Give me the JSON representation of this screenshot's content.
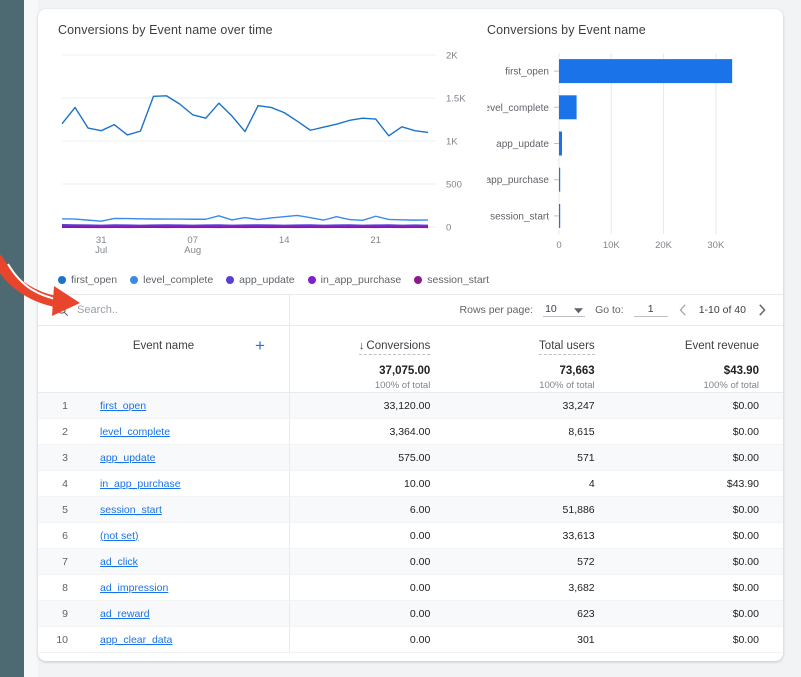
{
  "theme": {
    "accent": "#1a73e8",
    "rail": "#4d6a72",
    "bar_fill": "#1a73e8",
    "annotation": "#e8452c",
    "text_primary": "#202124",
    "text_secondary": "#5f6368"
  },
  "search": {
    "placeholder": "Search..",
    "value": "",
    "icon": "search-icon"
  },
  "pager": {
    "rows_per_page_label": "Rows per page:",
    "rows_per_page_value": "10",
    "goto_label": "Go to:",
    "goto_value": "1",
    "range": "1-10 of 40",
    "prev_icon": "chevron-left-icon",
    "next_icon": "chevron-right-icon",
    "dropdown_icon": "caret-down-icon"
  },
  "table": {
    "dimension_header": "Event name",
    "add_dimension_icon": "plus-icon",
    "metrics": [
      {
        "header": "Conversions",
        "total": "37,075.00",
        "subtotal": "100% of total",
        "sorted": true,
        "sort_icon": "arrow-down-icon",
        "dotted": true
      },
      {
        "header": "Total users",
        "total": "73,663",
        "subtotal": "100% of total",
        "sorted": false,
        "dotted": true
      },
      {
        "header": "Event revenue",
        "total": "$43.90",
        "subtotal": "100% of total",
        "sorted": false,
        "dotted": false
      }
    ],
    "rows": [
      {
        "index": "1",
        "name": "first_open",
        "conversions": "33,120.00",
        "total_users": "33,247",
        "event_revenue": "$0.00"
      },
      {
        "index": "2",
        "name": "level_complete",
        "conversions": "3,364.00",
        "total_users": "8,615",
        "event_revenue": "$0.00"
      },
      {
        "index": "3",
        "name": "app_update",
        "conversions": "575.00",
        "total_users": "571",
        "event_revenue": "$0.00"
      },
      {
        "index": "4",
        "name": "in_app_purchase",
        "conversions": "10.00",
        "total_users": "4",
        "event_revenue": "$43.90"
      },
      {
        "index": "5",
        "name": "session_start",
        "conversions": "6.00",
        "total_users": "51,886",
        "event_revenue": "$0.00"
      },
      {
        "index": "6",
        "name": "(not set)",
        "conversions": "0.00",
        "total_users": "33,613",
        "event_revenue": "$0.00"
      },
      {
        "index": "7",
        "name": "ad_click",
        "conversions": "0.00",
        "total_users": "572",
        "event_revenue": "$0.00"
      },
      {
        "index": "8",
        "name": "ad_impression",
        "conversions": "0.00",
        "total_users": "3,682",
        "event_revenue": "$0.00"
      },
      {
        "index": "9",
        "name": "ad_reward",
        "conversions": "0.00",
        "total_users": "623",
        "event_revenue": "$0.00"
      },
      {
        "index": "10",
        "name": "app_clear_data",
        "conversions": "0.00",
        "total_users": "301",
        "event_revenue": "$0.00"
      }
    ]
  },
  "chart_data": [
    {
      "type": "line",
      "title": "Conversions by Event name over time",
      "xlabel": "",
      "ylabel": "",
      "ylim": [
        0,
        2000
      ],
      "yticks": [
        "0",
        "500",
        "1K",
        "1.5K",
        "2K"
      ],
      "ytick_values": [
        0,
        500,
        1000,
        1500,
        2000
      ],
      "grid": true,
      "legend_position": "bottom",
      "x": [
        "28 Jul",
        "29 Jul",
        "30 Jul",
        "31 Jul",
        "01 Aug",
        "02 Aug",
        "03 Aug",
        "04 Aug",
        "05 Aug",
        "06 Aug",
        "07 Aug",
        "08 Aug",
        "09 Aug",
        "10 Aug",
        "11 Aug",
        "12 Aug",
        "13 Aug",
        "14 Aug",
        "15 Aug",
        "16 Aug",
        "17 Aug",
        "18 Aug",
        "19 Aug",
        "20 Aug",
        "21 Aug",
        "22 Aug",
        "23 Aug",
        "24 Aug",
        "25 Aug"
      ],
      "xticks": [
        {
          "pos": 3,
          "line1": "31",
          "line2": "Jul"
        },
        {
          "pos": 10,
          "line1": "07",
          "line2": "Aug"
        },
        {
          "pos": 17,
          "line1": "14",
          "line2": ""
        },
        {
          "pos": 24,
          "line1": "21",
          "line2": ""
        }
      ],
      "series": [
        {
          "name": "first_open",
          "color": "#1a73c8",
          "values": [
            1200,
            1390,
            1150,
            1120,
            1190,
            1070,
            1115,
            1520,
            1525,
            1430,
            1305,
            1265,
            1440,
            1290,
            1110,
            1410,
            1390,
            1330,
            1230,
            1125,
            1160,
            1195,
            1240,
            1265,
            1255,
            1060,
            1165,
            1120,
            1100
          ]
        },
        {
          "name": "level_complete",
          "color": "#3b8ae8",
          "values": [
            95,
            92,
            80,
            68,
            100,
            98,
            95,
            93,
            92,
            92,
            90,
            90,
            130,
            82,
            110,
            86,
            105,
            120,
            135,
            108,
            80,
            120,
            86,
            78,
            125,
            88,
            84,
            80,
            82
          ]
        },
        {
          "name": "app_update",
          "color": "#5b3fd4",
          "values": [
            26,
            24,
            22,
            20,
            24,
            22,
            20,
            22,
            24,
            22,
            20,
            22,
            24,
            20,
            22,
            24,
            22,
            20,
            22,
            24,
            20,
            22,
            24,
            20,
            22,
            24,
            20,
            22,
            20
          ]
        },
        {
          "name": "in_app_purchase",
          "color": "#7d22c9",
          "values": [
            14,
            12,
            12,
            10,
            12,
            10,
            12,
            14,
            12,
            10,
            12,
            10,
            12,
            10,
            12,
            10,
            12,
            14,
            12,
            10,
            12,
            10,
            12,
            14,
            12,
            10,
            12,
            10,
            12
          ]
        },
        {
          "name": "session_start",
          "color": "#8e1a8e",
          "values": [
            6,
            6,
            5,
            5,
            6,
            5,
            6,
            6,
            5,
            6,
            5,
            6,
            5,
            6,
            5,
            6,
            5,
            6,
            5,
            6,
            5,
            6,
            5,
            6,
            5,
            6,
            5,
            6,
            5
          ]
        }
      ]
    },
    {
      "type": "bar",
      "orientation": "horizontal",
      "title": "Conversions by Event name",
      "categories": [
        "first_open",
        "level_complete",
        "app_update",
        "in_app_purchase",
        "session_start"
      ],
      "values": [
        33120,
        3364,
        575,
        10,
        6
      ],
      "xlabel": "",
      "ylabel": "",
      "xlim": [
        0,
        35000
      ],
      "xticks": [
        "0",
        "10K",
        "20K",
        "30K"
      ],
      "xtick_values": [
        0,
        10000,
        20000,
        30000
      ],
      "grid": true,
      "color": "#1a73e8"
    }
  ],
  "annotation": {
    "name": "red-arrow-pointing-to-search",
    "color": "#e8452c"
  }
}
